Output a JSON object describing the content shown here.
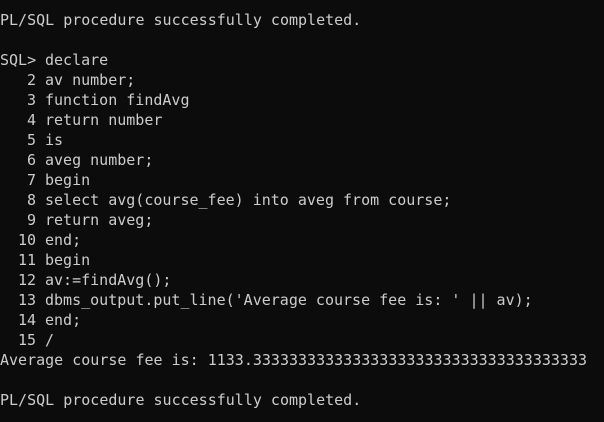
{
  "terminal": {
    "status_top": "PL/SQL procedure successfully completed.",
    "prompt": "SQL>",
    "first_line": "declare",
    "lines": [
      {
        "num": "2",
        "text": "av number;"
      },
      {
        "num": "3",
        "text": "function findAvg"
      },
      {
        "num": "4",
        "text": "return number"
      },
      {
        "num": "5",
        "text": "is"
      },
      {
        "num": "6",
        "text": "aveg number;"
      },
      {
        "num": "7",
        "text": "begin"
      },
      {
        "num": "8",
        "text": "select avg(course_fee) into aveg from course;"
      },
      {
        "num": "9",
        "text": "return aveg;"
      },
      {
        "num": "10",
        "text": "end;"
      },
      {
        "num": "11",
        "text": "begin"
      },
      {
        "num": "12",
        "text": "av:=findAvg();"
      },
      {
        "num": "13",
        "text": "dbms_output.put_line('Average course fee is: ' || av);"
      },
      {
        "num": "14",
        "text": "end;"
      },
      {
        "num": "15",
        "text": "/"
      }
    ],
    "output": "Average course fee is: 1133.3333333333333333333333333333333333333",
    "status_bottom": "PL/SQL procedure successfully completed."
  },
  "colors": {
    "background": "#0c0c0c",
    "text": "#cccccc"
  }
}
